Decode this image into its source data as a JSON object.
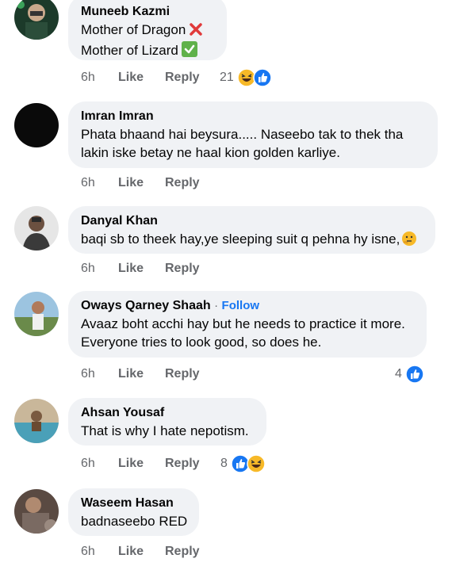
{
  "comments": [
    {
      "author": "Muneeb Kazmi",
      "lines": [
        "Mother of Dragon",
        "Mother of Lizard"
      ],
      "line_marks": [
        "cross-mark-icon",
        "check-mark-icon"
      ],
      "time": "6h",
      "like": "Like",
      "reply": "Reply",
      "reaction_count": "21",
      "reactions": [
        "haha-reaction-icon",
        "like-reaction-icon"
      ]
    },
    {
      "author": "Imran Imran",
      "lines": [
        "Phata bhaand hai beysura..... Naseebo tak to thek tha",
        "lakin iske betay ne haal kion golden karliye."
      ],
      "time": "6h",
      "like": "Like",
      "reply": "Reply"
    },
    {
      "author": "Danyal Khan",
      "lines": [
        "baqi sb to theek hay,ye sleeping suit q pehna hy isne,"
      ],
      "line_marks": [
        "thinking-face-icon"
      ],
      "time": "6h",
      "like": "Like",
      "reply": "Reply"
    },
    {
      "author": "Oways Qarney Shaah",
      "separator": "·",
      "follow": "Follow",
      "lines": [
        "Avaaz boht acchi hay but he needs to practice it more.",
        "Everyone tries to look good, so does he."
      ],
      "time": "6h",
      "like": "Like",
      "reply": "Reply",
      "reaction_count": "4",
      "reactions": [
        "like-reaction-icon"
      ]
    },
    {
      "author": "Ahsan Yousaf",
      "lines": [
        "That is why I hate nepotism."
      ],
      "time": "6h",
      "like": "Like",
      "reply": "Reply",
      "reaction_count": "8",
      "reactions": [
        "like-reaction-icon",
        "haha-reaction-icon"
      ]
    },
    {
      "author": "Waseem Hasan",
      "lines": [
        "badnaseebo RED"
      ],
      "time": "6h",
      "like": "Like",
      "reply": "Reply"
    }
  ],
  "colors": {
    "bubble": "#f0f2f5",
    "meta_text": "#65676b",
    "link_blue": "#1877f2",
    "like_blue": "#1877f2",
    "haha_yellow": "#f7b928"
  }
}
